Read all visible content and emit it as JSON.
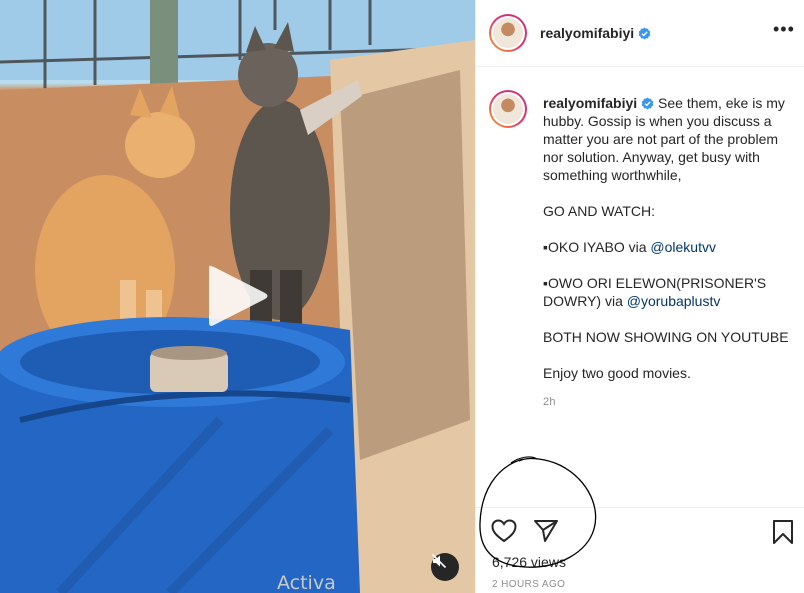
{
  "post": {
    "username": "realyomifabiyi",
    "verified": true,
    "more_label": "•••",
    "caption": {
      "lead": "See them, eke is my hubby. Gossip is when you discuss a matter you are not part of the problem nor solution. Anyway, get busy with something worthwhile,",
      "line2": "GO AND WATCH:",
      "line3_prefix": "▪OKO IYABO via ",
      "line3_mention": "@olekutvv",
      "line4_prefix": "▪OWO ORI ELEWON(PRISONER'S DOWRY) via ",
      "line4_mention": "@yorubaplustv",
      "line5": "BOTH NOW SHOWING ON YOUTUBE",
      "line6": "Enjoy two good movies."
    },
    "relative_time": "2h",
    "views_count": "6,726",
    "views_label": " views",
    "timestamp": "2 HOURS AGO"
  },
  "media": {
    "type": "video",
    "play_icon": "play-icon",
    "mute_icon": "volume-muted-icon"
  },
  "overlay": {
    "watermark": "Activa"
  },
  "icons": {
    "like": "heart-icon",
    "share": "paper-plane-icon",
    "save": "bookmark-icon",
    "verified": "verified-badge-icon"
  },
  "colors": {
    "accent": "#3897f0",
    "link": "#00376b",
    "muted": "#8e8e8e"
  }
}
